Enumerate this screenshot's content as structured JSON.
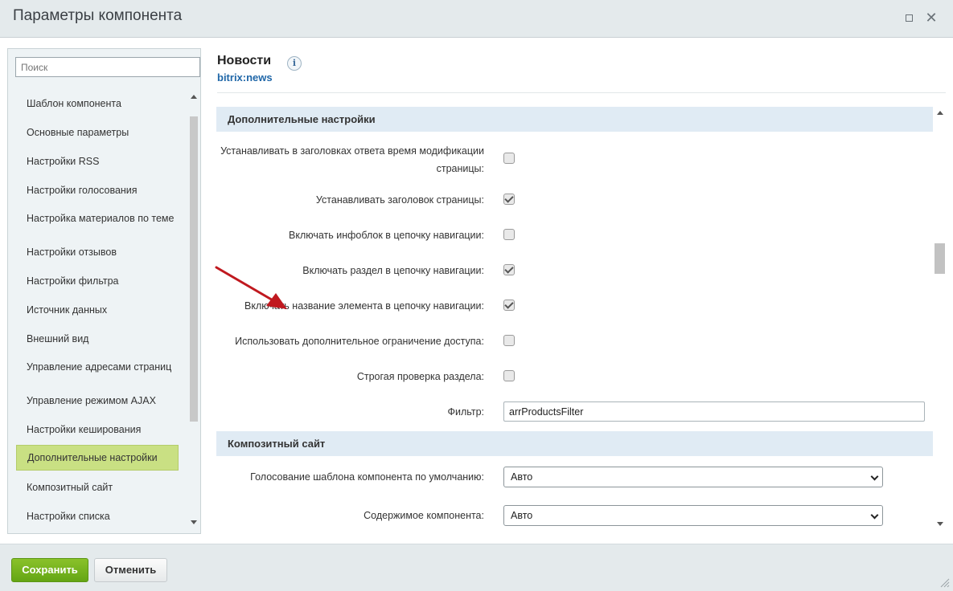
{
  "window": {
    "title": "Параметры компонента",
    "maximize_icon": "maximize-icon",
    "close_icon": "close-icon",
    "close_glyph": "✕"
  },
  "sidebar": {
    "search_placeholder": "Поиск",
    "items": [
      {
        "label": "Шаблон компонента",
        "active": false
      },
      {
        "label": "Основные параметры",
        "active": false
      },
      {
        "label": "Настройки RSS",
        "active": false
      },
      {
        "label": "Настройки голосования",
        "active": false
      },
      {
        "label": "Настройка материалов по теме",
        "active": false
      },
      {
        "label": "Настройки отзывов",
        "active": false
      },
      {
        "label": "Настройки фильтра",
        "active": false
      },
      {
        "label": "Источник данных",
        "active": false
      },
      {
        "label": "Внешний вид",
        "active": false
      },
      {
        "label": "Управление адресами страниц",
        "active": false
      },
      {
        "label": "Управление режимом AJAX",
        "active": false
      },
      {
        "label": "Настройки кеширования",
        "active": false
      },
      {
        "label": "Дополнительные настройки",
        "active": true
      },
      {
        "label": "Композитный сайт",
        "active": false
      },
      {
        "label": "Настройки списка",
        "active": false
      }
    ]
  },
  "component": {
    "name": "Новости",
    "code": "bitrix:news",
    "info_glyph": "i"
  },
  "sections": {
    "additional": {
      "title": "Дополнительные настройки",
      "rows": [
        {
          "label": "Устанавливать в заголовках ответа время модификации страницы:",
          "checked": false
        },
        {
          "label": "Устанавливать заголовок страницы:",
          "checked": true
        },
        {
          "label": "Включать инфоблок в цепочку навигации:",
          "checked": false
        },
        {
          "label": "Включать раздел в цепочку навигации:",
          "checked": true
        },
        {
          "label": "Включать название элемента в цепочку навигации:",
          "checked": true
        },
        {
          "label": "Использовать дополнительное ограничение доступа:",
          "checked": false
        },
        {
          "label": "Строгая проверка раздела:",
          "checked": false
        }
      ],
      "filter": {
        "label": "Фильтр:",
        "value": "arrProductsFilter"
      }
    },
    "composite": {
      "title": "Композитный сайт",
      "rows": [
        {
          "label": "Голосование шаблона компонента по умолчанию:",
          "value": "Авто"
        },
        {
          "label": "Содержимое компонента:",
          "value": "Авто"
        }
      ]
    }
  },
  "footer": {
    "save_label": "Сохранить",
    "cancel_label": "Отменить"
  },
  "colors": {
    "save_green": "#6aab17",
    "active_item": "#c9e083",
    "section_header": "#e0ebf4",
    "annotation_arrow": "#c0191f"
  }
}
